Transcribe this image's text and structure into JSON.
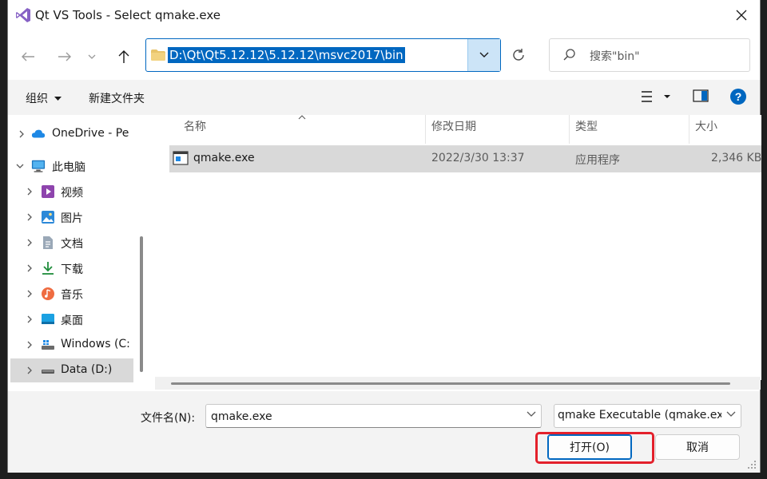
{
  "window": {
    "title": "Qt VS Tools - Select qmake.exe"
  },
  "address": {
    "path": "D:\\Qt\\Qt5.12.12\\5.12.12\\msvc2017\\bin"
  },
  "search": {
    "placeholder": "搜索\"bin\""
  },
  "commands": {
    "organize": "组织",
    "new_folder": "新建文件夹"
  },
  "sidebar": {
    "items": [
      {
        "label": "OneDrive - Pe",
        "icon": "cloud-icon"
      },
      {
        "label": "此电脑",
        "icon": "computer-icon"
      },
      {
        "label": "视频",
        "icon": "video-icon"
      },
      {
        "label": "图片",
        "icon": "pictures-icon"
      },
      {
        "label": "文档",
        "icon": "document-icon"
      },
      {
        "label": "下载",
        "icon": "download-icon"
      },
      {
        "label": "音乐",
        "icon": "music-icon"
      },
      {
        "label": "桌面",
        "icon": "desktop-icon"
      },
      {
        "label": "Windows (C:",
        "icon": "drive-icon"
      },
      {
        "label": "Data (D:)",
        "icon": "drive-icon"
      }
    ]
  },
  "columns": {
    "name": "名称",
    "modified": "修改日期",
    "type": "类型",
    "size": "大小"
  },
  "files": [
    {
      "name": "qmake.exe",
      "modified": "2022/3/30 13:37",
      "type": "应用程序",
      "size": "2,346 KB"
    }
  ],
  "footer": {
    "filename_label": "文件名(N):",
    "filename_value": "qmake.exe",
    "filter": "qmake Executable (qmake.exe)",
    "open_label": "打开(O)",
    "cancel_label": "取消"
  },
  "colors": {
    "accent": "#0067c0",
    "highlight_box": "#e3202b"
  }
}
